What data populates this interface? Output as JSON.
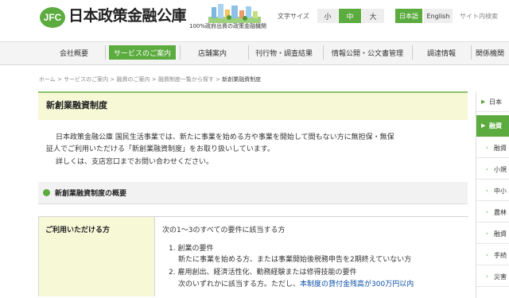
{
  "header": {
    "logo_mark": "JFC",
    "logo_text": "日本政策金融公庫",
    "tagline": "100%政府出資の政策金融機関",
    "font_size_label": "文字サイズ",
    "font_sizes": [
      "小",
      "中",
      "大"
    ],
    "lang_japanese": "日本語",
    "lang_english": "English",
    "site_search": "サイト内検索"
  },
  "nav": {
    "items": [
      {
        "label": "会社概要"
      },
      {
        "label": "サービスのご案内"
      },
      {
        "label": "店舗案内"
      },
      {
        "label": "刊行物・調査結果"
      },
      {
        "label": "情報公開・公文書管理"
      },
      {
        "label": "調達情報"
      },
      {
        "label": "関係機関"
      }
    ]
  },
  "breadcrumb": {
    "items": [
      "ホーム",
      "サービスのご案内",
      "融資のご案内",
      "融資制度一覧から探す",
      "新創業融資制度"
    ],
    "separator": ">"
  },
  "page": {
    "title": "新創業融資制度",
    "intro_line1": "日本政策金融公庫 国民生活事業では、新たに事業を始める方や事業を開始して間もない方に無担保・無保",
    "intro_line2": "証人でご利用いただける「新創業融資制度」をお取り扱いしています。",
    "intro_line3": "詳しくは、支店窓口までお問い合わせください。",
    "section_title": "新創業融資制度の概要"
  },
  "table": {
    "row_header": "ご利用いただける方",
    "lead": "次の1～3のすべての要件に該当する方",
    "item1_title": "1. 創業の要件",
    "item1_detail": "新たに事業を始める方、または事業開始後税務申告を2期終えていない方",
    "item2_title": "2. 雇用創出、経済活性化、勤務経験または修得技能の要件",
    "item2_detail_prefix": "次のいずれかに該当する方。ただし、",
    "item2_detail_link": "本制度の貸付金残高が300万円以内"
  },
  "sidebar": {
    "items": [
      {
        "label": "日本"
      },
      {
        "label": "融資"
      },
      {
        "label": "融資"
      },
      {
        "label": "小規"
      },
      {
        "label": "中小"
      },
      {
        "label": "農林"
      },
      {
        "label": "融資"
      },
      {
        "label": "手続"
      },
      {
        "label": "災害"
      }
    ]
  },
  "colors": {
    "brand_green": "#5bab3f",
    "title_bg": "#f6f8d6",
    "link_blue": "#0a4fa8"
  }
}
